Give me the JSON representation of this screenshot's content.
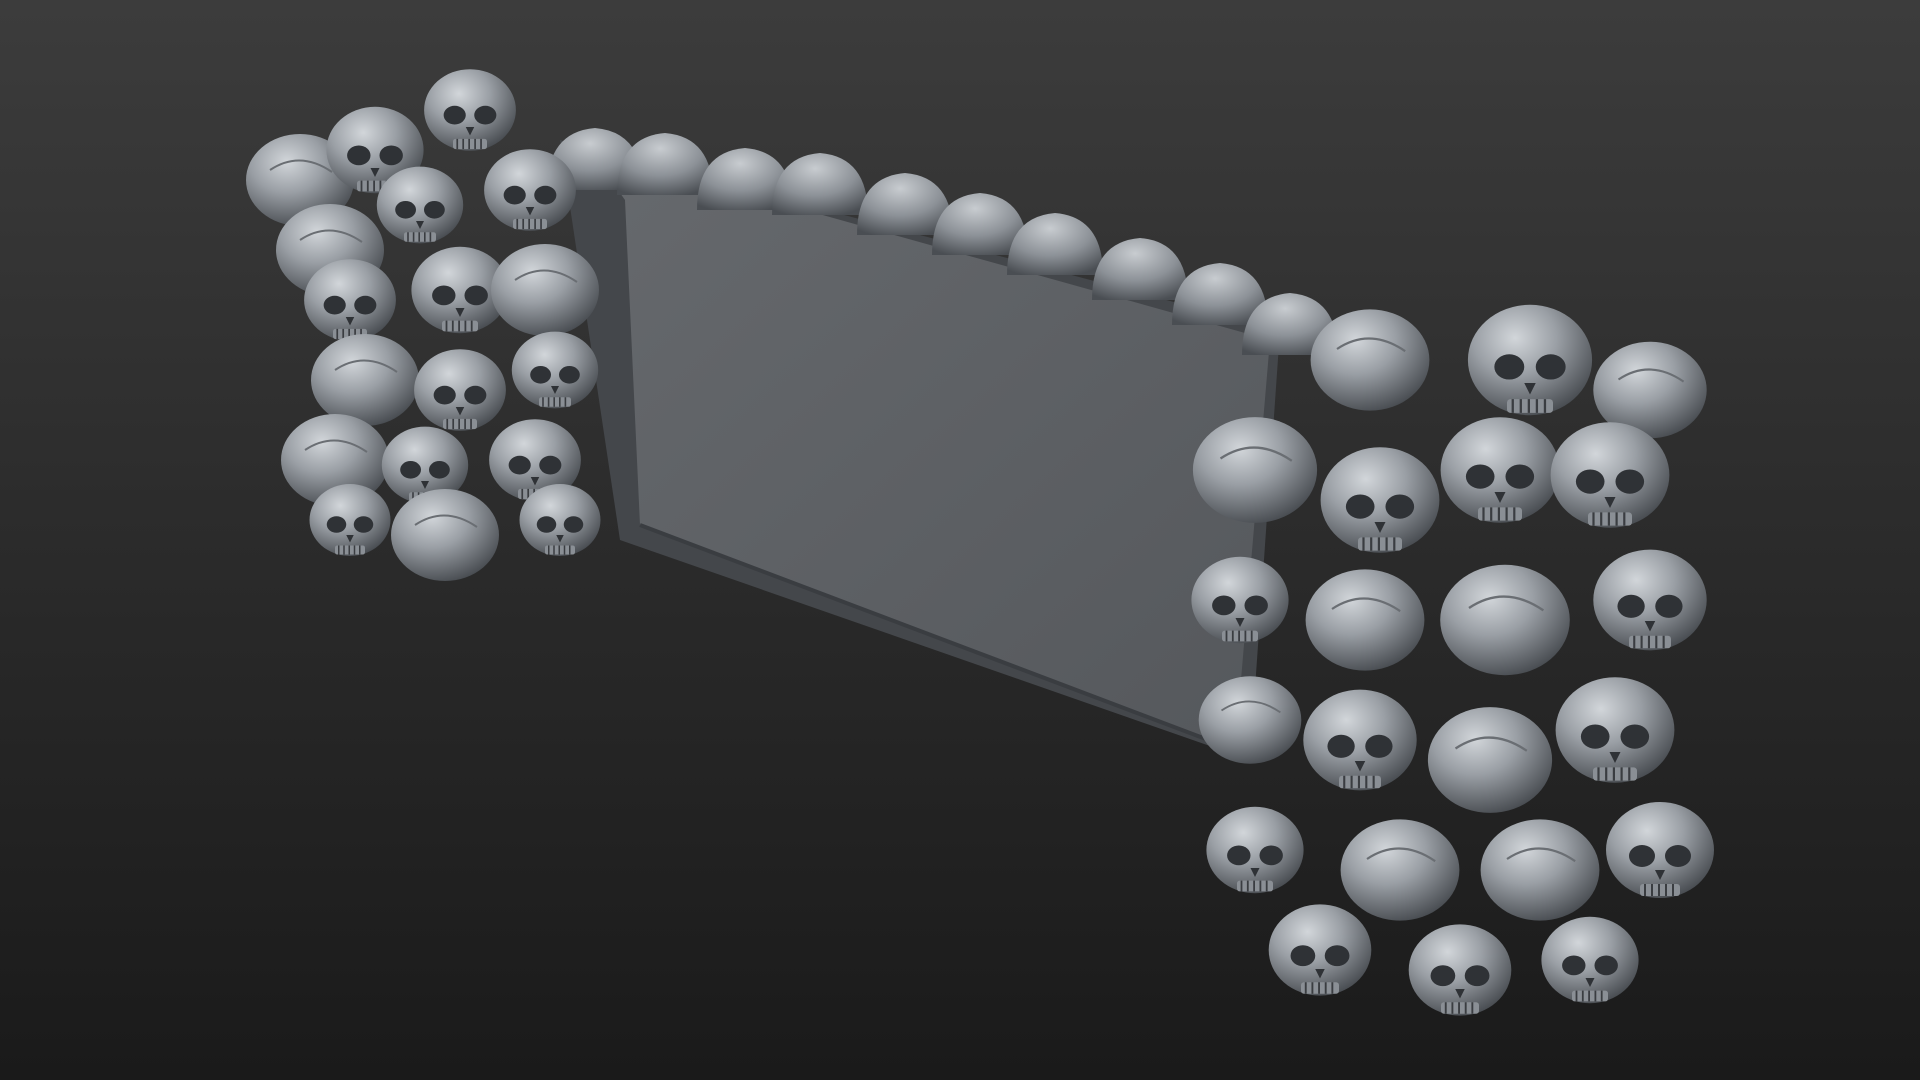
{
  "scene": {
    "subject": "skull-pile-wall-sculpt",
    "colors": {
      "background_top": "#3c3c3c",
      "background_bottom": "#1a1a1a",
      "clay_light": "#c4c8cc",
      "clay_mid": "#8f949a",
      "clay_dark": "#4d5156",
      "wall_face": "#5c5f63",
      "wall_shadow": "#44474b"
    }
  }
}
